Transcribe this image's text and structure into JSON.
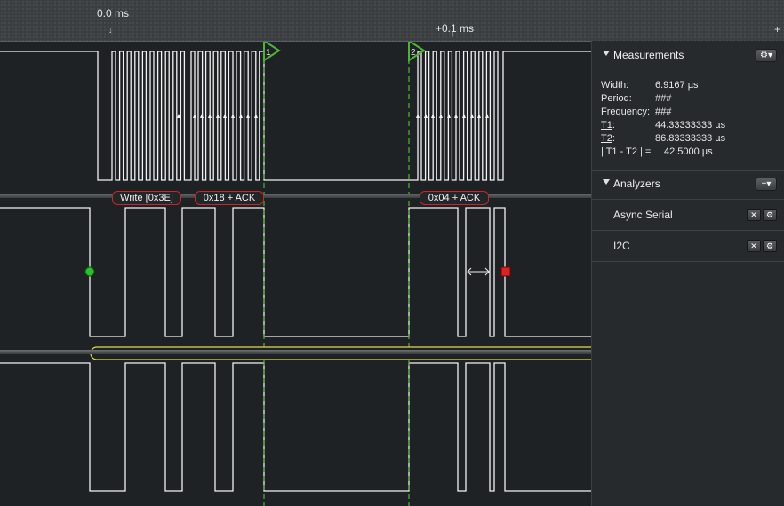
{
  "timebar": {
    "t0_label": "0.0 ms",
    "t1_label": "+0.1 ms",
    "tick_glyph": "↓",
    "add_icon": "+"
  },
  "markers": {
    "m1": "1",
    "m2": "2",
    "color": "#4fb33a"
  },
  "decoded": [
    {
      "text": "Write [0x3E]"
    },
    {
      "text": "0x18 + ACK"
    },
    {
      "text": "0x04 + ACK"
    }
  ],
  "measurements": {
    "title": "Measurements",
    "gear_icon": "gear-icon",
    "width_label": "Width:",
    "width_value": "6.9167 µs",
    "period_label": "Period:",
    "period_value": "###",
    "frequency_label": "Frequency:",
    "frequency_value": "###",
    "t1_label": "T1",
    "t1_colon": ":",
    "t1_value": "44.33333333 µs",
    "t2_label": "T2",
    "t2_colon": ":",
    "t2_value": "86.83333333 µs",
    "diff_label": "| T1 - T2 | =",
    "diff_value": "42.5000 µs"
  },
  "analyzers": {
    "title": "Analyzers",
    "add_label": "+",
    "items": [
      {
        "name": "Async Serial"
      },
      {
        "name": "I2C"
      }
    ]
  },
  "colors": {
    "waveform": "#f2f2f2",
    "decoded_border": "#c7262b",
    "start_marker": "#27c22b",
    "stop_marker": "#e32020",
    "highlight": "#e3d84a"
  }
}
